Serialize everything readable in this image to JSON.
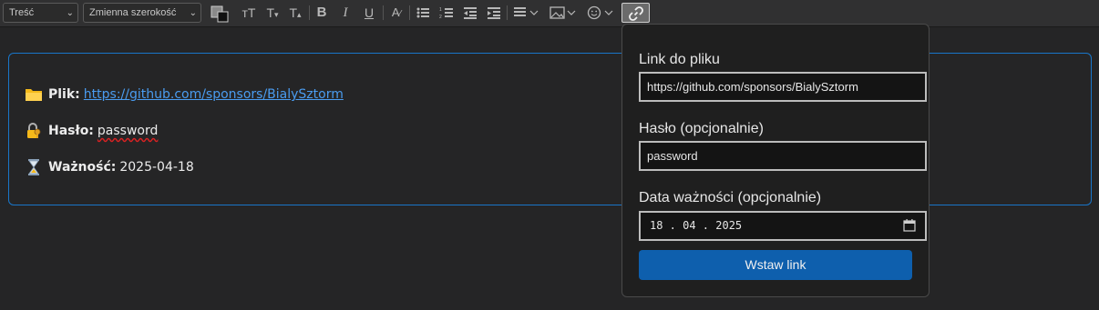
{
  "toolbar": {
    "style_select": "Treść",
    "width_select": "Zmienna szerokość"
  },
  "content": {
    "file_label": "Plik:",
    "file_link": "https://github.com/sponsors/BialySztorm",
    "password_label": "Hasło:",
    "password_value": "password",
    "expiry_label": "Ważność:",
    "expiry_value": "2025-04-18"
  },
  "popup": {
    "link_label": "Link do pliku",
    "link_value": "https://github.com/sponsors/BialySztorm",
    "password_label": "Hasło (opcjonalnie)",
    "password_value": "password",
    "date_label": "Data ważności (opcjonalnie)",
    "date_value": "18 . 04 . 2025",
    "submit_label": "Wstaw link"
  },
  "colors": {
    "accent": "#1976c9",
    "button": "#0e5fad",
    "link": "#4a9cf0"
  }
}
